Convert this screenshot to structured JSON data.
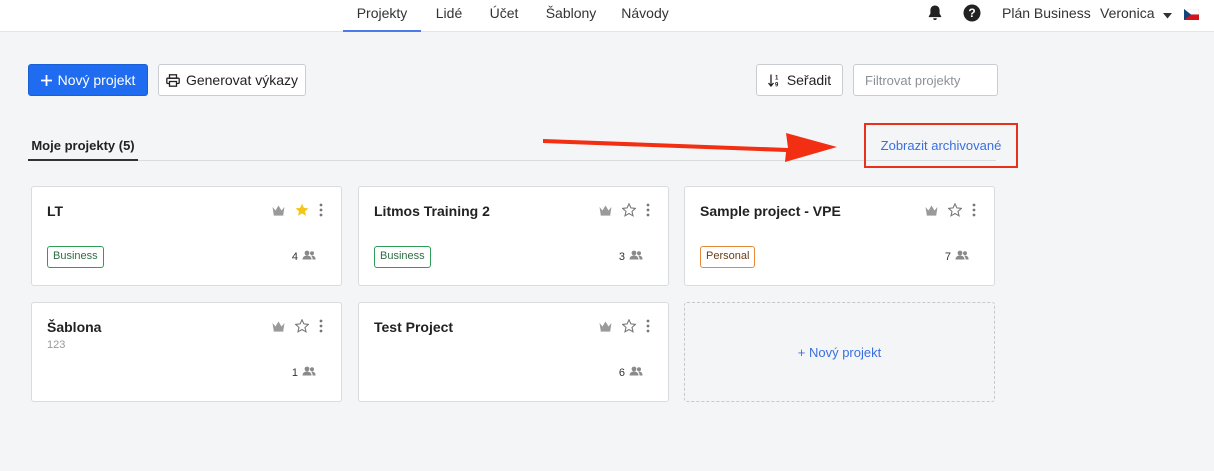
{
  "nav": {
    "tabs": [
      {
        "label": "Projekty",
        "active": true
      },
      {
        "label": "Lidé"
      },
      {
        "label": "Účet"
      },
      {
        "label": "Šablony"
      },
      {
        "label": "Návody"
      }
    ],
    "plan_label": "Plán Business",
    "user_name": "Veronica",
    "language_flag": "cz-flag-icon"
  },
  "toolbar": {
    "new_project_label": "Nový projekt",
    "generate_reports_label": "Generovat výkazy",
    "sort_label": "Seřadit",
    "filter_placeholder": "Filtrovat projekty",
    "filter_value": ""
  },
  "section": {
    "my_projects_tab": "Moje projekty (5)",
    "show_archived_link": "Zobrazit archivované"
  },
  "projects": [
    {
      "title": "LT",
      "subtitle": "",
      "badge": "Business",
      "members": "4",
      "starred": true
    },
    {
      "title": "Litmos Training 2",
      "subtitle": "",
      "badge": "Business",
      "members": "3",
      "starred": false
    },
    {
      "title": "Sample project - VPE",
      "subtitle": "",
      "badge": "Personal",
      "members": "7",
      "starred": false
    },
    {
      "title": "Šablona",
      "subtitle": "123",
      "badge": "",
      "members": "1",
      "starred": false
    },
    {
      "title": "Test Project",
      "subtitle": "",
      "badge": "",
      "members": "6",
      "starred": false
    }
  ],
  "new_project_card_label": "+ Nový projekt",
  "colors": {
    "primary": "#1f6cf0",
    "link": "#3b6fde",
    "highlight_annotation": "#e8301c",
    "star_active": "#f5c518",
    "badge_business": "#2e9e57",
    "badge_personal": "#e5893a"
  }
}
